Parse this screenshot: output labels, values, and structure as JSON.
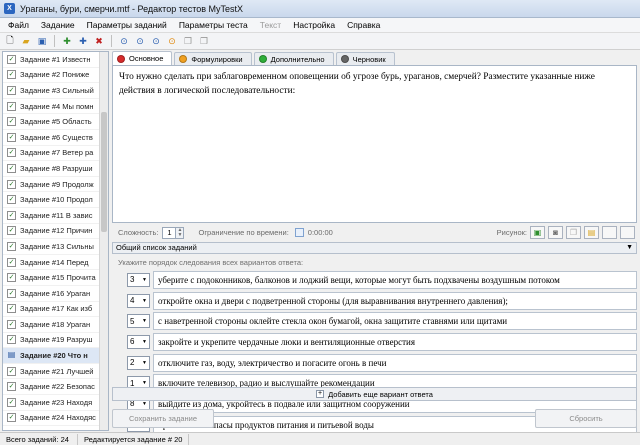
{
  "window": {
    "title": "Ураганы, бури, смерчи.mtf - Редактор тестов MyTestX",
    "icon": "app-icon"
  },
  "menu": [
    {
      "label": "Файл",
      "enabled": true
    },
    {
      "label": "Задание",
      "enabled": true
    },
    {
      "label": "Параметры заданий",
      "enabled": true
    },
    {
      "label": "Параметры теста",
      "enabled": true
    },
    {
      "label": "Текст",
      "enabled": false
    },
    {
      "label": "Настройка",
      "enabled": true
    },
    {
      "label": "Справка",
      "enabled": true
    }
  ],
  "toolbar": {
    "icons": [
      "new-file-icon",
      "open-folder-icon",
      "save-icon",
      "add-task-icon",
      "insert-task-icon",
      "delete-task-icon",
      "move-up-icon",
      "move-down-icon",
      "preview-icon",
      "check-icon",
      "copy-icon",
      "paste-icon"
    ]
  },
  "tasks": [
    {
      "label": "Задание #1 Известн",
      "checked": true
    },
    {
      "label": "Задание #2 Пониже",
      "checked": true
    },
    {
      "label": "Задание #3 Сильный",
      "checked": true
    },
    {
      "label": "Задание #4 Мы помн",
      "checked": true
    },
    {
      "label": "Задание #5 Область",
      "checked": true
    },
    {
      "label": "Задание #6 Существ",
      "checked": true
    },
    {
      "label": "Задание #7 Ветер ра",
      "checked": true
    },
    {
      "label": "Задание #8 Разруши",
      "checked": true
    },
    {
      "label": "Задание #9 Продолж",
      "checked": true
    },
    {
      "label": "Задание #10 Продол",
      "checked": true
    },
    {
      "label": "Задание #11 В завис",
      "checked": true
    },
    {
      "label": "Задание #12 Причин",
      "checked": true
    },
    {
      "label": "Задание #13 Сильны",
      "checked": true
    },
    {
      "label": "Задание #14 Перед",
      "checked": true
    },
    {
      "label": "Задание #15 Прочита",
      "checked": true
    },
    {
      "label": "Задание #16 Ураган",
      "checked": true
    },
    {
      "label": "Задание #17 Как изб",
      "checked": true
    },
    {
      "label": "Задание #18 Ураган",
      "checked": true
    },
    {
      "label": "Задание #19 Разруш",
      "checked": true
    },
    {
      "label": "Задание #20 Что н",
      "checked": true,
      "active": true
    },
    {
      "label": "Задание #21 Лучшей",
      "checked": true
    },
    {
      "label": "Задание #22 Безопас",
      "checked": true
    },
    {
      "label": "Задание #23 Находя",
      "checked": true
    },
    {
      "label": "Задание #24 Находяс",
      "checked": true
    }
  ],
  "tabs": [
    {
      "label": "Основное",
      "color": "#d62b2b",
      "active": true
    },
    {
      "label": "Формулировки",
      "color": "#f0a020",
      "active": false
    },
    {
      "label": "Дополнительно",
      "color": "#2fae3a",
      "active": false
    },
    {
      "label": "Черновик",
      "color": "#666666",
      "active": false
    }
  ],
  "question": "Что нужно сделать при заблаговременном оповещении об угрозе бурь, ураганов, смерчей? Разместите указанные ниже действия в логической последовательности:",
  "props": {
    "difficulty_label": "Сложность:",
    "difficulty_value": "1",
    "time_limit_label": "Ограничение по времени:",
    "time_value": "0:00:00",
    "picture_label": "Рисунок:"
  },
  "list_header": "Общий список заданий",
  "hint": "Укажите порядок следования всех вариантов ответа:",
  "answers": [
    {
      "order": "3",
      "text": "уберите с подоконников, балконов и лоджий вещи, которые могут быть подхвачены воздушным потоком"
    },
    {
      "order": "4",
      "text": "откройте окна и двери с подветренной стороны (для выравнивания внутреннего давления);"
    },
    {
      "order": "5",
      "text": "с наветренной стороны оклейте стекла окон бумагой, окна защитите ставнями или щитами"
    },
    {
      "order": "6",
      "text": "закройте и укрепите чердачные люки и вентиляционные отверстия"
    },
    {
      "order": "2",
      "text": "отключите газ, воду, электричество и погасите огонь в печи"
    },
    {
      "order": "1",
      "text": "включите телевизор, радио и выслушайте рекомендации"
    },
    {
      "order": "8",
      "text": "выйдите из дома, укройтесь в подвале или защитном сооружении"
    },
    {
      "order": "7",
      "text": "приготовьте запасы продуктов питания и питьевой воды"
    }
  ],
  "add_answer": "Добавить еще вариант ответа",
  "buttons": {
    "save": "Сохранить задание",
    "reset": "Сбросить"
  },
  "status": {
    "total": "Всего заданий: 24",
    "editing": "Редактируется задание # 20"
  }
}
